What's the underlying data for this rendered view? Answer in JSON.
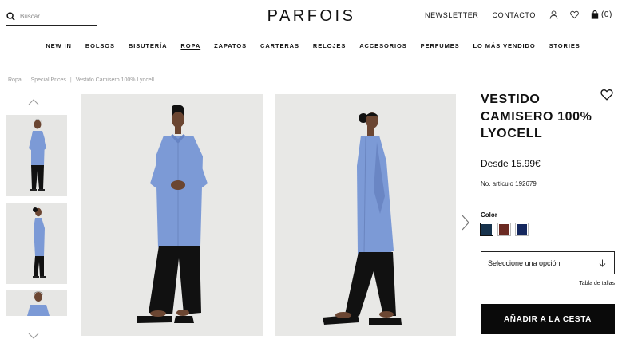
{
  "header": {
    "brand": "PARFOIS",
    "search_placeholder": "Buscar",
    "newsletter": "NEWSLETTER",
    "contact": "CONTACTO",
    "cart_count": "(0)",
    "icons": [
      "search-icon",
      "user-icon",
      "heart-icon",
      "bag-icon"
    ]
  },
  "nav": {
    "items": [
      "NEW IN",
      "BOLSOS",
      "BISUTERÍA",
      "ROPA",
      "ZAPATOS",
      "CARTERAS",
      "RELOJES",
      "ACCESORIOS",
      "PERFUMES",
      "LO MÁS VENDIDO",
      "STORIES"
    ],
    "active": "ROPA"
  },
  "breadcrumb": {
    "items": [
      "Ropa",
      "Special Prices",
      "Vestido Camisero 100% Lyocell"
    ]
  },
  "product": {
    "title": "VESTIDO CAMISERO 100% LYOCELL",
    "price": "Desde 15.99€",
    "reference": "No. artículo 192679",
    "color_label": "Color",
    "swatches": [
      "#17334d",
      "#6b2a22",
      "#14275e"
    ],
    "selected_swatch": 0,
    "size_placeholder": "Seleccione una opción",
    "size_guide": "Tabla de tallas",
    "add_to_cart": "AÑADIR A LA CESTA"
  },
  "colors": {
    "dress": "#7c9ad6",
    "trousers": "#111111",
    "photo_bg": "#e8e8e6",
    "skin": "#6b4632"
  }
}
